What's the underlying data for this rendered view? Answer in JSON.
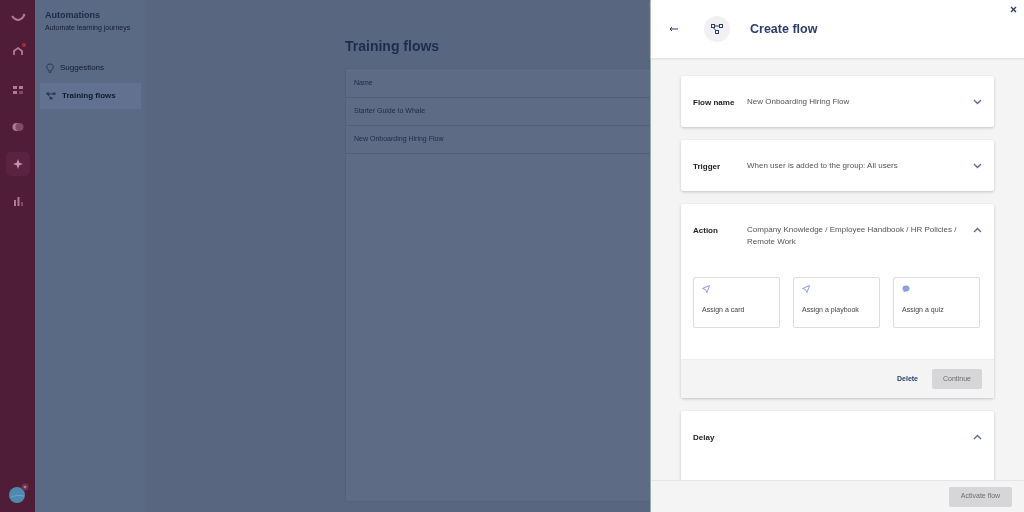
{
  "rail": {
    "items": [
      {
        "selected": false,
        "alert": true
      },
      {
        "selected": false,
        "alert": false
      },
      {
        "selected": false,
        "alert": false
      },
      {
        "selected": true,
        "alert": false
      },
      {
        "selected": false,
        "alert": false
      }
    ]
  },
  "subnav": {
    "title": "Automations",
    "subtitle": "Automate learning journeys",
    "items": [
      {
        "label": "Suggestions",
        "selected": false,
        "kind": "bulb"
      },
      {
        "label": "Training flows",
        "selected": true,
        "kind": "flow"
      }
    ]
  },
  "main": {
    "title": "Training flows",
    "table": {
      "columns": [
        "Name"
      ],
      "rows": [
        [
          "Starter Guide to Whale"
        ],
        [
          "New Onboarding Hiring Flow"
        ]
      ]
    }
  },
  "panel": {
    "title": "Create flow",
    "sections": [
      {
        "kind": "field",
        "label": "Flow name",
        "value": "New Onboarding Hiring Flow",
        "expanded": false
      },
      {
        "kind": "field",
        "label": "Trigger",
        "value": "When user is added to the group: All users",
        "expanded": false
      },
      {
        "kind": "action",
        "label": "Action",
        "value": "Company Knowledge / Employee Handbook / HR Policies / Remote Work",
        "expanded": true,
        "options": [
          {
            "label": "Assign a card",
            "kind": "plane"
          },
          {
            "label": "Assign a playbook",
            "kind": "plane"
          },
          {
            "label": "Assign a quiz",
            "kind": "bubble"
          }
        ],
        "delete": "Delete",
        "continue": {
          "label": "Continue",
          "disabled": true
        }
      },
      {
        "kind": "section",
        "label": "Delay",
        "expanded": true
      }
    ],
    "activate": {
      "label": "Activate flow",
      "disabled": true
    }
  }
}
